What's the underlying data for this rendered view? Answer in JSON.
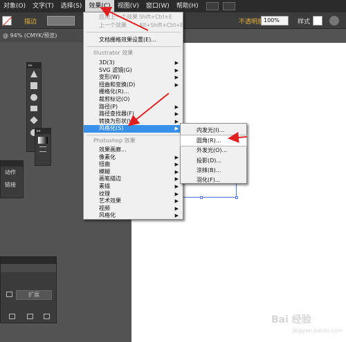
{
  "menubar": {
    "items": [
      {
        "label": "对象(O)"
      },
      {
        "label": "文字(T)"
      },
      {
        "label": "选择(S)"
      },
      {
        "label": "效果(C)",
        "active": true
      },
      {
        "label": "视图(V)"
      },
      {
        "label": "窗口(W)"
      },
      {
        "label": "帮助(H)"
      }
    ]
  },
  "controlbar": {
    "stroke_label": "描边",
    "opacity_label": "不透明度",
    "opacity_value": "100%",
    "style_label": "样式"
  },
  "doctab": {
    "label": "@ 94% (CMYK/预览)"
  },
  "effect_menu": {
    "apply_last": {
      "label": "应用上一个效果",
      "shortcut": "Shift+Ctrl+E"
    },
    "last_effect": {
      "label": "上一个效果",
      "shortcut": "Alt+Shift+Ctrl+E"
    },
    "raster_settings": "文档栅格效果设置(E)...",
    "illustrator_header": "Illustrator 效果",
    "illustrator_items": [
      "3D(3)",
      "SVG 滤镜(G)",
      "变形(W)",
      "扭曲和变换(D)",
      "栅格化(R)...",
      "裁剪标记(O)",
      "路径(P)",
      "路径查找器(F)",
      "转换为形状(V)",
      "风格化(S)"
    ],
    "photoshop_header": "Photoshop 效果",
    "photoshop_items": [
      "效果画廊...",
      "像素化",
      "扭曲",
      "模糊",
      "画笔描边",
      "素描",
      "纹理",
      "艺术效果",
      "视频",
      "风格化"
    ]
  },
  "stylize_submenu": {
    "items": [
      "内发光(I)...",
      "圆角(R)...",
      "外发光(O)...",
      "投影(D)...",
      "涂抹(B)...",
      "羽化(F)..."
    ]
  },
  "actions_panel": {
    "items": [
      "动作",
      "链接"
    ]
  },
  "bottom_panel": {
    "expand_label": "扩展"
  },
  "watermark": {
    "logo": "Bai 经验",
    "url": "jingyan.baidu.com"
  },
  "colors": {
    "highlight": "#3790ea",
    "annotation": "#e02020",
    "menubar": "#2b2b2b",
    "workspace": "#535353"
  }
}
